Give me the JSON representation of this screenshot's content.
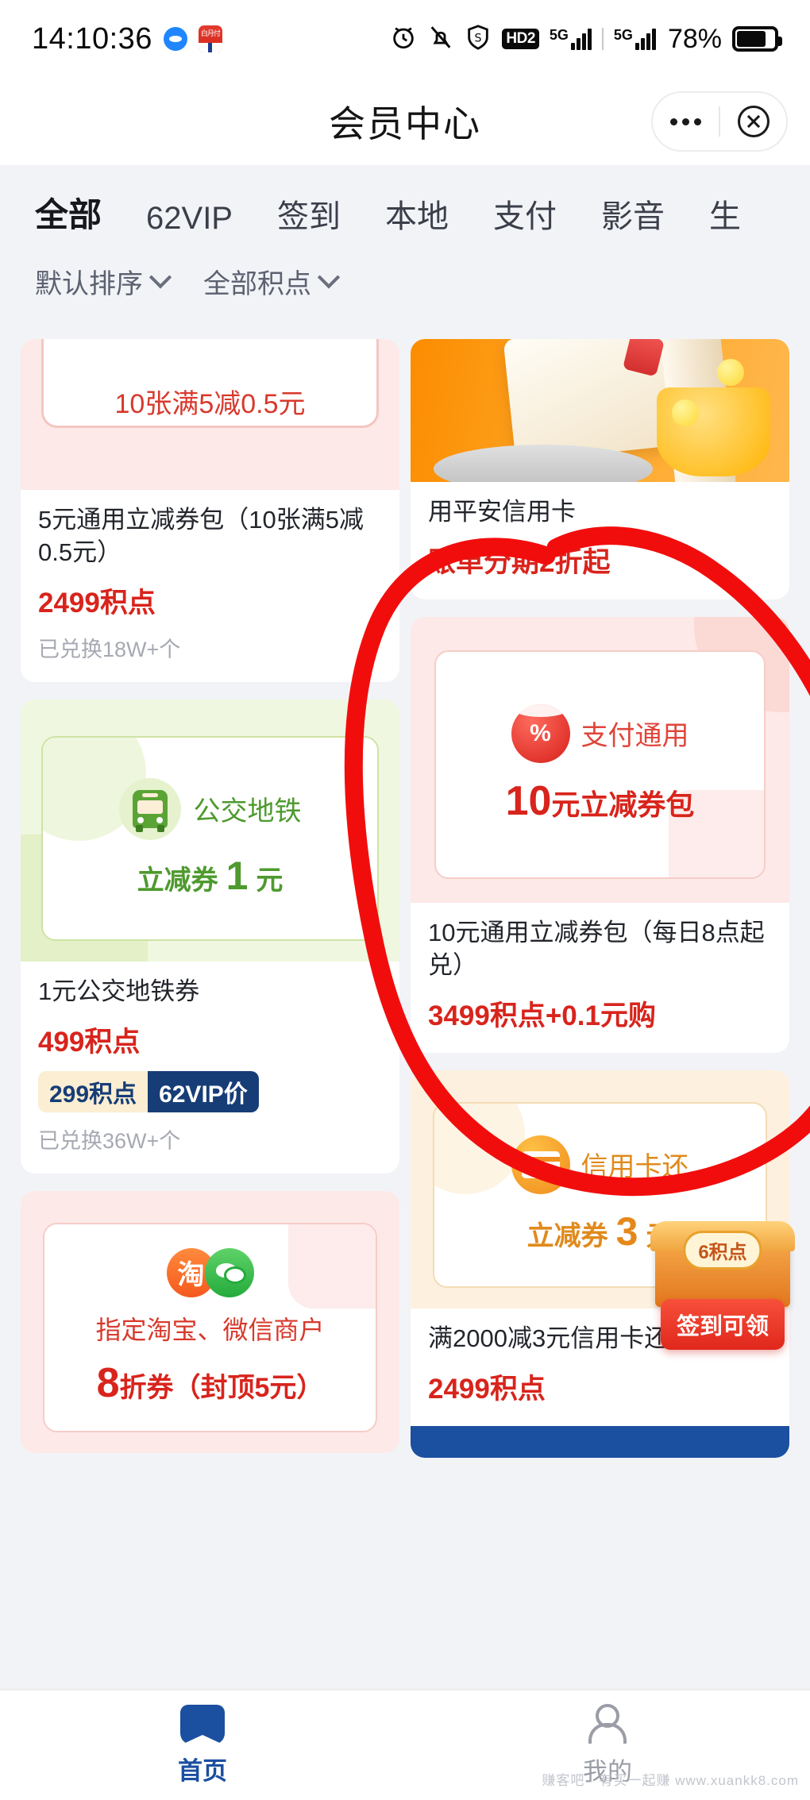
{
  "statusbar": {
    "time": "14:10:36",
    "app_badge_text": "白月付",
    "hd_label": "HD2",
    "network_1": "5G",
    "network_2": "5G",
    "battery_percent": "78%"
  },
  "header": {
    "title": "会员中心",
    "more_icon": "more-dots-icon",
    "close_icon": "close-circle-icon"
  },
  "tabs": [
    {
      "label": "全部",
      "active": true
    },
    {
      "label": "62VIP",
      "active": false
    },
    {
      "label": "签到",
      "active": false
    },
    {
      "label": "本地",
      "active": false
    },
    {
      "label": "支付",
      "active": false
    },
    {
      "label": "影音",
      "active": false
    },
    {
      "label": "生",
      "active": false
    }
  ],
  "filters": [
    {
      "label": "默认排序",
      "icon": "chevron-down-icon"
    },
    {
      "label": "全部积点",
      "icon": "chevron-down-icon"
    }
  ],
  "cards": {
    "coupon5": {
      "banner_text": "10张满5减0.5元",
      "title": "5元通用立减券包（10张满5减0.5元）",
      "price": "2499积点",
      "sold": "已兑换18W+个"
    },
    "pingan": {
      "title": "用平安信用卡",
      "subtitle": "账单分期2折起"
    },
    "bus": {
      "badge_label": "公交地铁",
      "coupon_label": "立减券",
      "coupon_amount": "1",
      "coupon_unit": "元",
      "title": "1元公交地铁券",
      "price": "499积点",
      "vip_price": "299积点",
      "vip_tag": "62VIP价",
      "sold": "已兑换36W+个"
    },
    "coupon10": {
      "badge_label": "支付通用",
      "percent_icon": "percent-redpacket-icon",
      "amount": "10",
      "amount_suffix": "元立减券包",
      "title": "10元通用立减券包（每日8点起兑）",
      "price": "3499积点+0.1元购"
    },
    "creditcard": {
      "badge_label": "信用卡还",
      "coupon_label": "立减券",
      "coupon_amount": "3",
      "coupon_unit": "元",
      "title": "满2000减3元信用卡还款券",
      "price": "2499积点"
    },
    "taobao": {
      "line1": "指定淘宝、微信商户",
      "amount": "8",
      "amount_suffix": "折券（封顶5元）",
      "tao_glyph": "淘"
    }
  },
  "float_badge": {
    "points_text": "6积点",
    "button_label": "签到可领"
  },
  "bottom_nav": [
    {
      "label": "首页",
      "icon": "home-icon",
      "active": true
    },
    {
      "label": "我的",
      "icon": "user-icon",
      "active": false
    }
  ],
  "watermark": "赚客吧 · 有买一起赚  www.xuankk8.com",
  "colors": {
    "accent_red": "#d8241c",
    "brand_blue": "#1b4fa0",
    "annotation_red": "#f20d0d",
    "green": "#4e9a2e",
    "orange": "#e08a1c"
  }
}
